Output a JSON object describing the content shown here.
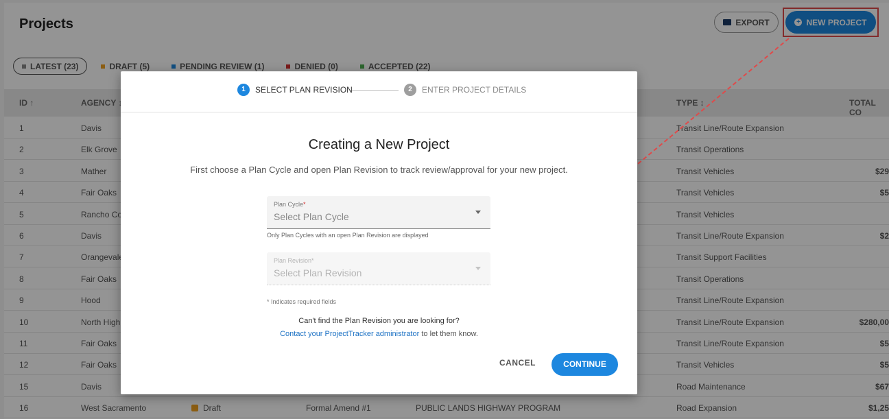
{
  "page": {
    "title": "Projects",
    "export_label": "EXPORT",
    "new_project_label": "NEW PROJECT"
  },
  "tabs": [
    {
      "label": "LATEST (23)",
      "color": "#888888"
    },
    {
      "label": "DRAFT (5)",
      "color": "#f0a020"
    },
    {
      "label": "PENDING REVIEW (1)",
      "color": "#1d87df"
    },
    {
      "label": "DENIED (0)",
      "color": "#d32f2f"
    },
    {
      "label": "ACCEPTED (22)",
      "color": "#4caf50"
    }
  ],
  "table": {
    "columns": {
      "id": "ID ↑",
      "agency": "AGENCY ↕",
      "type": "TYPE ↕",
      "total": "TOTAL CO"
    },
    "rows": [
      {
        "id": "1",
        "agency": "Davis",
        "status": "",
        "revision": "",
        "program": "",
        "type": "Transit Line/Route Expansion",
        "total": ""
      },
      {
        "id": "2",
        "agency": "Elk Grove",
        "status": "",
        "revision": "",
        "program": "",
        "type": "Transit Operations",
        "total": ""
      },
      {
        "id": "3",
        "agency": "Mather",
        "status": "",
        "revision": "",
        "program": "",
        "type": "Transit Vehicles",
        "total": "$29"
      },
      {
        "id": "4",
        "agency": "Fair Oaks",
        "status": "",
        "revision": "",
        "program": "",
        "type": "Transit Vehicles",
        "total": "$5"
      },
      {
        "id": "5",
        "agency": "Rancho Co",
        "status": "",
        "revision": "",
        "program": "",
        "type": "Transit Vehicles",
        "total": ""
      },
      {
        "id": "6",
        "agency": "Davis",
        "status": "",
        "revision": "",
        "program": "",
        "type": "Transit Line/Route Expansion",
        "total": "$2"
      },
      {
        "id": "7",
        "agency": "Orangevale",
        "status": "",
        "revision": "",
        "program": "",
        "type": "Transit Support Facilities",
        "total": ""
      },
      {
        "id": "8",
        "agency": "Fair Oaks",
        "status": "",
        "revision": "",
        "program": "",
        "type": "Transit Operations",
        "total": ""
      },
      {
        "id": "9",
        "agency": "Hood",
        "status": "",
        "revision": "",
        "program": "",
        "type": "Transit Line/Route Expansion",
        "total": ""
      },
      {
        "id": "10",
        "agency": "North High",
        "status": "",
        "revision": "",
        "program": "",
        "type": "Transit Line/Route Expansion",
        "total": "$280,00"
      },
      {
        "id": "11",
        "agency": "Fair Oaks",
        "status": "",
        "revision": "",
        "program": "",
        "type": "Transit Line/Route Expansion",
        "total": "$5"
      },
      {
        "id": "12",
        "agency": "Fair Oaks",
        "status": "",
        "revision": "",
        "program": "",
        "type": "Transit Vehicles",
        "total": "$5"
      },
      {
        "id": "15",
        "agency": "Davis",
        "status": "",
        "revision": "",
        "program": "",
        "type": "Road Maintenance",
        "total": "$67"
      },
      {
        "id": "16",
        "agency": "West Sacramento",
        "status": "Draft",
        "revision": "Formal Amend #1",
        "program": "PUBLIC LANDS HIGHWAY PROGRAM",
        "type": "Road Expansion",
        "total": "$1,25"
      }
    ]
  },
  "modal": {
    "step1_num": "1",
    "step1_label": "SELECT PLAN REVISION",
    "step2_num": "2",
    "step2_label": "ENTER PROJECT DETAILS",
    "title": "Creating a New Project",
    "description": "First choose a Plan Cycle and open Plan Revision to track review/approval for your new project.",
    "plan_cycle_label": "Plan Cycle",
    "plan_cycle_placeholder": "Select Plan Cycle",
    "plan_cycle_hint": "Only Plan Cycles with an open Plan Revision are displayed",
    "plan_revision_label": "Plan Revision",
    "plan_revision_placeholder": "Select Plan Revision",
    "required_asterisk": "*",
    "required_note": "* Indicates required fields",
    "help_question": "Can't find the Plan Revision you are looking for?",
    "help_link": "Contact your ProjectTracker administrator",
    "help_suffix": " to let them know.",
    "cancel_label": "CANCEL",
    "continue_label": "CONTINUE"
  },
  "colors": {
    "accent": "#1d87df",
    "highlight": "#e04a4a",
    "draft": "#f0a020"
  }
}
